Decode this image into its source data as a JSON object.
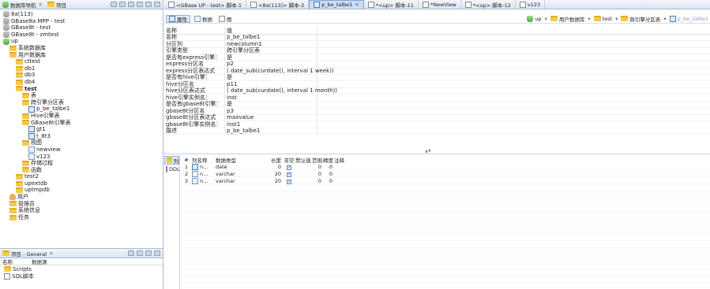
{
  "nav": {
    "tab1": "数据库导航",
    "tab2": "项目",
    "tree": [
      {
        "label": "8a(113)",
        "icon": "db",
        "indent": 0
      },
      {
        "label": "GBase8a MPP - test",
        "icon": "db",
        "indent": 0
      },
      {
        "label": "GBase8t - test",
        "icon": "db",
        "indent": 0
      },
      {
        "label": "GBase8t - zmtest",
        "icon": "db",
        "indent": 0
      },
      {
        "label": "up",
        "icon": "dbg",
        "indent": 0
      },
      {
        "label": "系统数据库",
        "icon": "folder",
        "indent": 1
      },
      {
        "label": "用户数据库",
        "icon": "folder",
        "indent": 1
      },
      {
        "label": "cttest",
        "icon": "folder",
        "indent": 2
      },
      {
        "label": "db1",
        "icon": "folder",
        "indent": 2
      },
      {
        "label": "db3",
        "icon": "folder",
        "indent": 2
      },
      {
        "label": "db4",
        "icon": "folder",
        "indent": 2
      },
      {
        "label": "test",
        "icon": "folder",
        "indent": 2,
        "bold": true
      },
      {
        "label": "表",
        "icon": "folder",
        "indent": 3
      },
      {
        "label": "跨引擎分区表",
        "icon": "folder",
        "indent": 3
      },
      {
        "label": "p_be_talbe1",
        "icon": "table",
        "indent": 4
      },
      {
        "label": "Hive引擎表",
        "icon": "folder",
        "indent": 3
      },
      {
        "label": "GBase8t引擎表",
        "icon": "folder",
        "indent": 3
      },
      {
        "label": "gt1",
        "icon": "table",
        "indent": 4
      },
      {
        "label": "t_8t3",
        "icon": "table",
        "indent": 4
      },
      {
        "label": "视图",
        "icon": "folder",
        "indent": 3
      },
      {
        "label": "newview",
        "icon": "view",
        "indent": 4
      },
      {
        "label": "v123",
        "icon": "view",
        "indent": 4
      },
      {
        "label": "存储过程",
        "icon": "folder",
        "indent": 3
      },
      {
        "label": "函数",
        "icon": "folder",
        "indent": 3
      },
      {
        "label": "test2",
        "icon": "folder",
        "indent": 2
      },
      {
        "label": "upextdb",
        "icon": "folder",
        "indent": 2
      },
      {
        "label": "uptmpdb",
        "icon": "folder",
        "indent": 2
      },
      {
        "label": "用户",
        "icon": "user",
        "indent": 1
      },
      {
        "label": "管理员",
        "icon": "folder",
        "indent": 1
      },
      {
        "label": "系统信息",
        "icon": "folder",
        "indent": 1
      },
      {
        "label": "任务",
        "icon": "folder",
        "indent": 1
      }
    ]
  },
  "projects": {
    "title": "项目 - General",
    "col_name": "名称",
    "col_source": "数据源",
    "items": [
      {
        "label": "Scripts",
        "icon": "folder"
      },
      {
        "label": "SQL脚本",
        "icon": "sql"
      }
    ]
  },
  "editor_tabs": [
    {
      "label": "<GBase UP - test> 脚本-1",
      "active": false
    },
    {
      "label": "<8a(113)> 脚本-3",
      "active": false
    },
    {
      "label": "p_be_talbe1",
      "active": true
    },
    {
      "label": "*<up> 脚本-11",
      "active": false
    },
    {
      "label": "*NewView",
      "active": false
    },
    {
      "label": "*<up> 脚本-12",
      "active": false
    },
    {
      "label": "v123",
      "active": false
    }
  ],
  "toolbar": {
    "properties": "属性",
    "data": "数据",
    "er": "图",
    "crumbs": [
      "up",
      "用户数据库",
      "test",
      "跨引擎分区表",
      "p_be_talbe1"
    ]
  },
  "props": {
    "header_name": "名称",
    "header_value": "值",
    "rows": [
      {
        "k": "名称",
        "v": "p_be_talbe1"
      },
      {
        "k": "分区列",
        "v": "newcolumn1"
      },
      {
        "k": "引擎类型",
        "v": "跨引擎分区表"
      },
      {
        "k": "是否有express引擎：",
        "v": "是"
      },
      {
        "k": "express分区名",
        "v": "p2"
      },
      {
        "k": "express分区表达式",
        "v": "( date_sub(curdate(), interval 1 week))"
      },
      {
        "k": "是否有hive引擎：",
        "v": "是"
      },
      {
        "k": "hive分区名",
        "v": "p11"
      },
      {
        "k": "hive分区表达式",
        "v": "( date_sub(curdate(), interval 1 month))"
      },
      {
        "k": "hive引擎实例名：",
        "v": "inst"
      },
      {
        "k": "是否有gbase8t引擎：",
        "v": "是"
      },
      {
        "k": "gbase8t分区名",
        "v": "p3"
      },
      {
        "k": "gbase8t分区表达式",
        "v": "maxvalue"
      },
      {
        "k": "gbase8t引擎实例名：",
        "v": "inst1"
      },
      {
        "k": "描述",
        "v": "p_be_talbe1"
      }
    ]
  },
  "side_tabs": [
    "列",
    "DDL"
  ],
  "columns": {
    "headers": [
      "#",
      "列名称",
      "数据类型",
      "长度",
      "非空",
      "默认值",
      "范围",
      "精度",
      "注释"
    ],
    "rows": [
      {
        "idx": "1",
        "name": "n...",
        "type": "date",
        "len": "0",
        "notnull": true,
        "scale": "0",
        "prec": "0"
      },
      {
        "idx": "2",
        "name": "n...",
        "type": "varchar",
        "len": "20",
        "notnull": true,
        "scale": "0",
        "prec": "0"
      },
      {
        "idx": "3",
        "name": "n...",
        "type": "varchar",
        "len": "20",
        "notnull": true,
        "scale": "0",
        "prec": "0"
      }
    ]
  }
}
